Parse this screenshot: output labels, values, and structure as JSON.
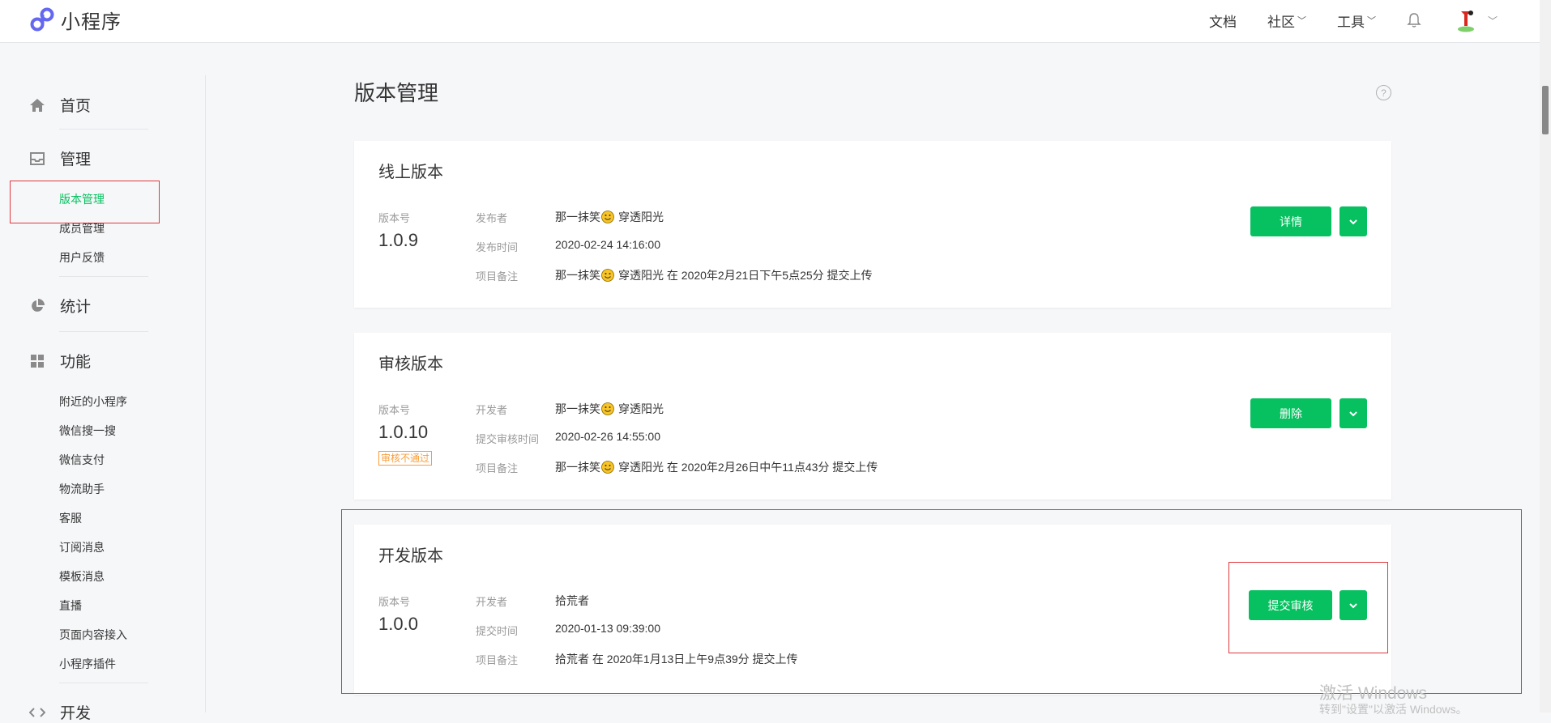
{
  "header": {
    "logo_text": "小程序",
    "nav": {
      "docs": "文档",
      "community": "社区",
      "tools": "工具"
    }
  },
  "sidebar": {
    "home": "首页",
    "manage": {
      "label": "管理",
      "items": [
        "版本管理",
        "成员管理",
        "用户反馈"
      ]
    },
    "stats": "统计",
    "features": {
      "label": "功能",
      "items": [
        "附近的小程序",
        "微信搜一搜",
        "微信支付",
        "物流助手",
        "客服",
        "订阅消息",
        "模板消息",
        "直播",
        "页面内容接入",
        "小程序插件"
      ]
    },
    "develop": "开发"
  },
  "page": {
    "title": "版本管理",
    "help": "?"
  },
  "online": {
    "title": "线上版本",
    "version_label": "版本号",
    "version": "1.0.9",
    "publisher_label": "发布者",
    "publisher_name": "那一抹笑",
    "publisher_name2": "穿透阳光",
    "time_label": "发布时间",
    "time": "2020-02-24 14:16:00",
    "note_label": "项目备注",
    "note_name": "那一抹笑",
    "note_rest": "穿透阳光 在 2020年2月21日下午5点25分 提交上传",
    "button": "详情"
  },
  "review": {
    "title": "审核版本",
    "version_label": "版本号",
    "version": "1.0.10",
    "badge": "审核不通过",
    "dev_label": "开发者",
    "dev_name": "那一抹笑",
    "dev_name2": "穿透阳光",
    "time_label": "提交审核时间",
    "time": "2020-02-26 14:55:00",
    "note_label": "项目备注",
    "note_name": "那一抹笑",
    "note_rest": "穿透阳光 在 2020年2月26日中午11点43分 提交上传",
    "button": "删除"
  },
  "dev": {
    "title": "开发版本",
    "version_label": "版本号",
    "version": "1.0.0",
    "dev_label": "开发者",
    "dev_name": "拾荒者",
    "time_label": "提交时间",
    "time": "2020-01-13 09:39:00",
    "note_label": "项目备注",
    "note": "拾荒者 在 2020年1月13日上午9点39分 提交上传",
    "button": "提交审核"
  },
  "watermark": {
    "line1": "激活 Windows",
    "line2": "转到\"设置\"以激活 Windows。"
  },
  "colors": {
    "accent": "#07c160",
    "warn": "#fa9d3b",
    "annotation": "#e0393e"
  }
}
